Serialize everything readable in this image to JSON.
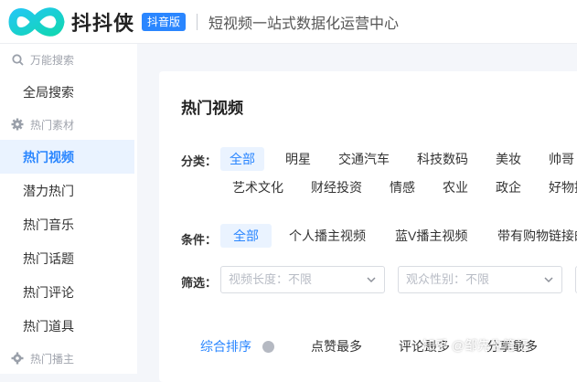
{
  "header": {
    "brand": "抖抖侠",
    "badge": "抖音版",
    "slogan": "短视频一站式数据化运营中心"
  },
  "sidebar": {
    "groups": [
      {
        "label": "万能搜索",
        "icon": "search-icon",
        "items": [
          "全局搜索"
        ]
      },
      {
        "label": "热门素材",
        "icon": "gear-icon",
        "items": [
          "热门视频",
          "潜力热门",
          "热门音乐",
          "热门话题",
          "热门评论",
          "热门道具"
        ]
      },
      {
        "label": "热门播主",
        "icon": "gear-icon",
        "items": []
      }
    ],
    "active_item": "热门视频"
  },
  "main": {
    "title": "热门视频",
    "category_label": "分类：",
    "categories_row1": [
      "全部",
      "明星",
      "交通汽车",
      "科技数码",
      "美妆",
      "帅哥"
    ],
    "categories_row2": [
      "艺术文化",
      "财经投资",
      "情感",
      "农业",
      "政企",
      "好物推"
    ],
    "condition_label": "条件：",
    "conditions": [
      "全部",
      "个人播主视频",
      "蓝V播主视频",
      "带有购物链接的"
    ],
    "filter_label": "筛选：",
    "filter_video_length": "视频长度：不限",
    "filter_audience_gender": "观众性别：不限",
    "sorts": [
      "综合排序",
      "点赞最多",
      "评论最多",
      "分享最多"
    ]
  },
  "watermark": "知乎 @邹先生笔记",
  "colors": {
    "accent": "#2a86ff",
    "active_bg": "#eaf3ff"
  }
}
